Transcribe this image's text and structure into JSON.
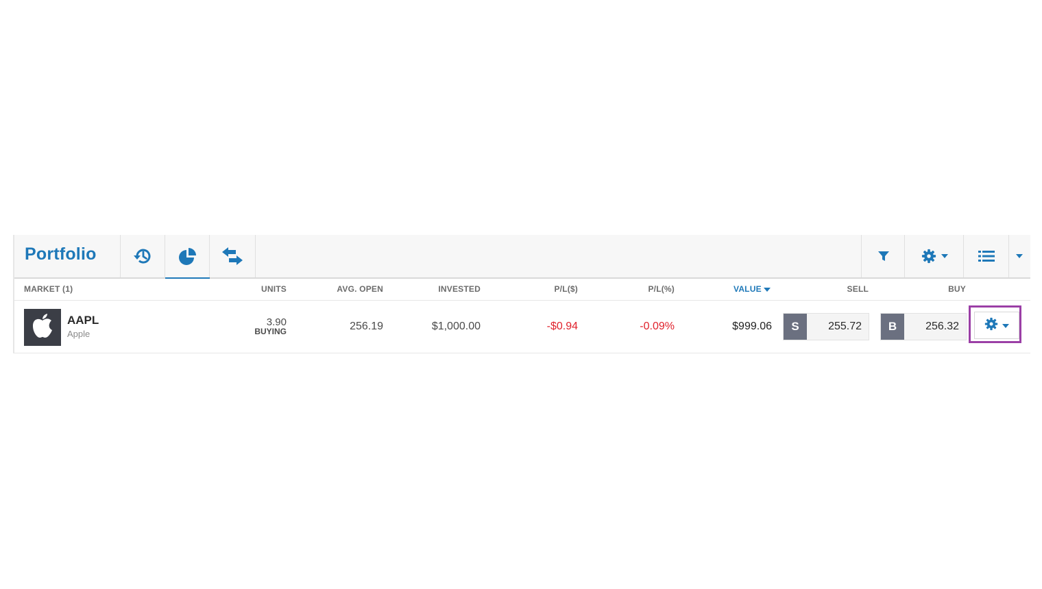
{
  "toolbar": {
    "title": "Portfolio"
  },
  "table": {
    "headers": {
      "market": "MARKET (1)",
      "units": "UNITS",
      "avg_open": "AVG. OPEN",
      "invested": "INVESTED",
      "pl_dollar": "P/L($)",
      "pl_percent": "P/L(%)",
      "value": "VALUE",
      "sell": "SELL",
      "buy": "BUY"
    },
    "rows": [
      {
        "ticker": "AAPL",
        "company": "Apple",
        "units": "3.90",
        "units_status": "BUYING",
        "avg_open": "256.19",
        "invested": "$1,000.00",
        "pl_dollar": "-$0.94",
        "pl_percent": "-0.09%",
        "value": "$999.06",
        "sell_tag": "S",
        "sell_price": "255.72",
        "buy_tag": "B",
        "buy_price": "256.32"
      }
    ]
  },
  "colors": {
    "accent": "#1e78b8",
    "negative": "#e0222c",
    "highlight": "#9b3fa6",
    "trade_tag": "#6b7080"
  },
  "icons": {
    "history": "history-icon",
    "allocation": "pie-chart-icon",
    "transfer": "swap-arrows-icon",
    "filter": "filter-icon",
    "settings": "gear-icon",
    "list": "list-icon",
    "dropdown": "caret-down-icon",
    "logo": "apple-logo-icon"
  }
}
